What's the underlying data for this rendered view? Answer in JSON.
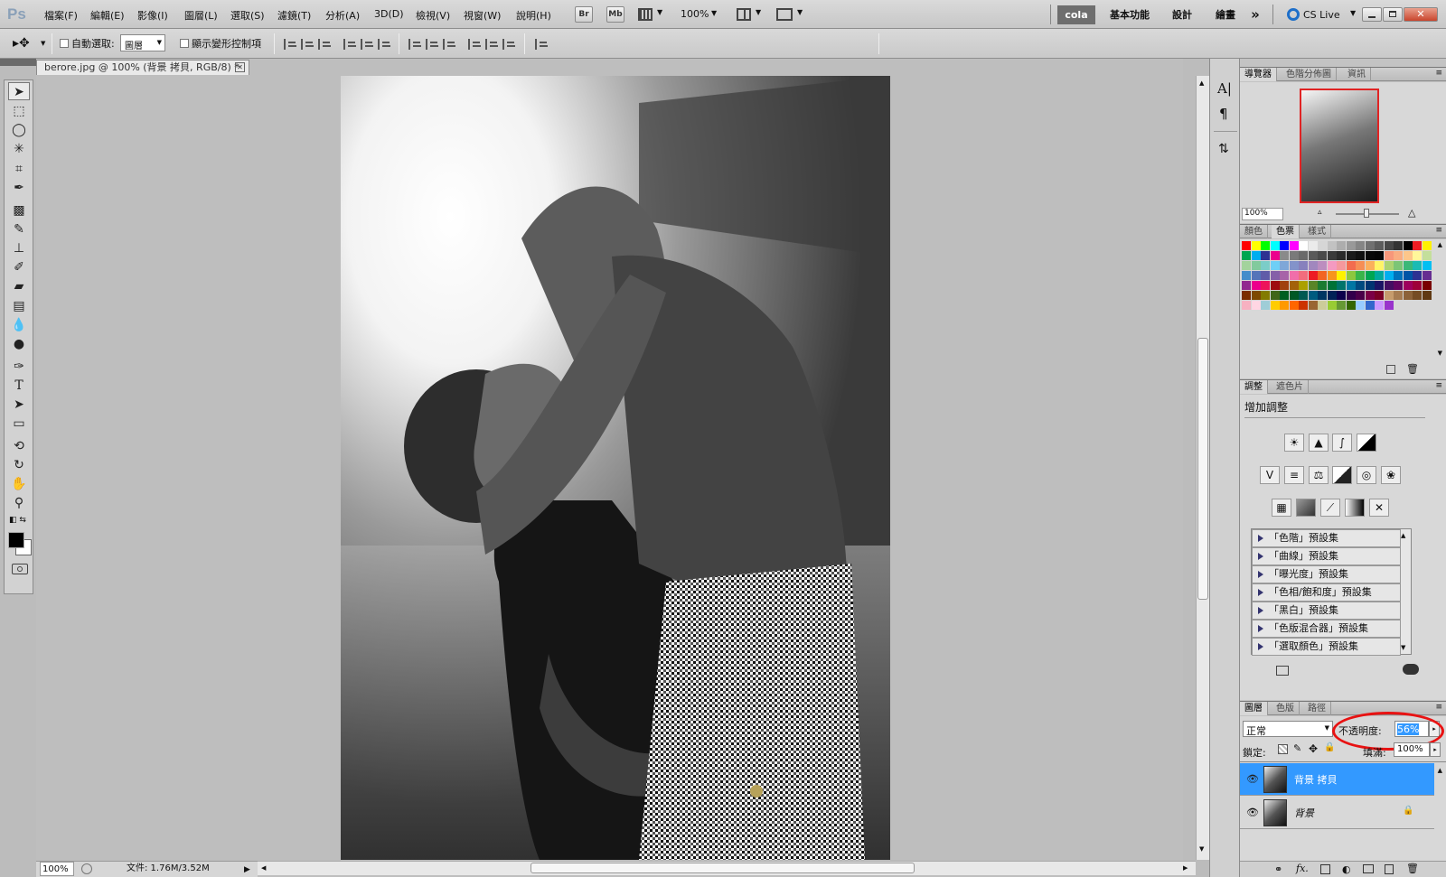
{
  "app": {
    "logo": "Ps",
    "accent": "#3399ff"
  },
  "menu": [
    "檔案(F)",
    "編輯(E)",
    "影像(I)",
    "圖層(L)",
    "選取(S)",
    "濾鏡(T)",
    "分析(A)",
    "3D(D)",
    "檢視(V)",
    "視窗(W)",
    "說明(H)"
  ],
  "appbar": {
    "br": "Br",
    "mb": "Mb",
    "zoom": "100%",
    "cola": "cola",
    "ws1": "基本功能",
    "ws2": "設計",
    "ws3": "繪畫",
    "more": "»",
    "cslive": "CS Live"
  },
  "options": {
    "auto_select": "自動選取:",
    "layer_select": "圖層",
    "show_transform": "顯示變形控制項"
  },
  "document": {
    "tab_title": "berore.jpg @ 100% (背景 拷貝, RGB/8) *",
    "zoom": "100%",
    "file_info": "文件: 1.76M/3.52M"
  },
  "navigator": {
    "tabs": [
      "導覽器",
      "色階分佈圖",
      "資訊"
    ],
    "zoom": "100%"
  },
  "swatches_panel": {
    "tabs": [
      "顏色",
      "色票",
      "樣式"
    ],
    "colors": [
      "#ff0000",
      "#ffff00",
      "#00ff00",
      "#00ffff",
      "#0000ff",
      "#ff00ff",
      "#ffffff",
      "#ebebeb",
      "#d6d6d6",
      "#c2c2c2",
      "#adadad",
      "#999999",
      "#858585",
      "#707070",
      "#5c5c5c",
      "#474747",
      "#333333",
      "#000000",
      "#ee1d24",
      "#fff100",
      "#00a650",
      "#00adef",
      "#2e3192",
      "#ec008c",
      "#8a8a8a",
      "#7a7a7a",
      "#6a6a6a",
      "#5a5a5a",
      "#4a4a4a",
      "#3a3a3a",
      "#2a2a2a",
      "#1a1a1a",
      "#101010",
      "#080808",
      "#050505",
      "#f7977a",
      "#f9ad81",
      "#fdc68a",
      "#fff79a",
      "#c4df9b",
      "#a3d39c",
      "#82ca9d",
      "#7bcdc8",
      "#6ecff6",
      "#7ea7d8",
      "#8393ca",
      "#8781bd",
      "#a187be",
      "#bc8dbf",
      "#f49ac1",
      "#f5989d",
      "#f26c4f",
      "#f68e55",
      "#fbaf5c",
      "#fff467",
      "#acd372",
      "#7cc576",
      "#3bb878",
      "#1abbb4",
      "#00bff3",
      "#438ccb",
      "#5574b9",
      "#605ca8",
      "#855fa8",
      "#a763a8",
      "#f06eaa",
      "#f26d7d",
      "#ed1c24",
      "#f26522",
      "#f7941d",
      "#fff200",
      "#8dc73f",
      "#39b54a",
      "#00a651",
      "#00a99d",
      "#00aeef",
      "#0072bc",
      "#0054a6",
      "#2e3192",
      "#662d91",
      "#92278f",
      "#ec008c",
      "#ed145b",
      "#9e0b0f",
      "#a0410d",
      "#a36209",
      "#aba000",
      "#598527",
      "#1a7b30",
      "#007236",
      "#00746b",
      "#0076a3",
      "#004a80",
      "#003471",
      "#1b1464",
      "#440e62",
      "#630460",
      "#9e005d",
      "#9e0039",
      "#790000",
      "#7b2e00",
      "#7d4900",
      "#827b00",
      "#406618",
      "#005e20",
      "#005826",
      "#005952",
      "#005b7f",
      "#003663",
      "#002157",
      "#0d004c",
      "#32004b",
      "#4b0049",
      "#7b0046",
      "#7a0026",
      "#c69c6d",
      "#a67c52",
      "#8c6239",
      "#754c24",
      "#603913",
      "#f7b1c1",
      "#ffd6e3",
      "#9fcdd7",
      "#ffcc00",
      "#ff9900",
      "#ff6600",
      "#cc3300",
      "#996633",
      "#cccc99",
      "#99cc33",
      "#669933",
      "#336600",
      "#99ccff",
      "#3366cc",
      "#cc99ff",
      "#9933cc"
    ]
  },
  "adjustments": {
    "tabs": [
      "調整",
      "遮色片"
    ],
    "heading": "增加調整",
    "presets": [
      "「色階」預設集",
      "「曲線」預設集",
      "「曝光度」預設集",
      "「色相/飽和度」預設集",
      "「黑白」預設集",
      "「色版混合器」預設集",
      "「選取顏色」預設集"
    ]
  },
  "layers": {
    "tabs": [
      "圖層",
      "色版",
      "路徑"
    ],
    "blend_mode": "正常",
    "opacity_label": "不透明度:",
    "opacity_value": "56%",
    "lock_label": "鎖定:",
    "fill_label": "填滿:",
    "fill_value": "100%",
    "items": [
      {
        "name": "背景 拷貝",
        "selected": true
      },
      {
        "name": "背景",
        "selected": false,
        "locked": true
      }
    ]
  }
}
